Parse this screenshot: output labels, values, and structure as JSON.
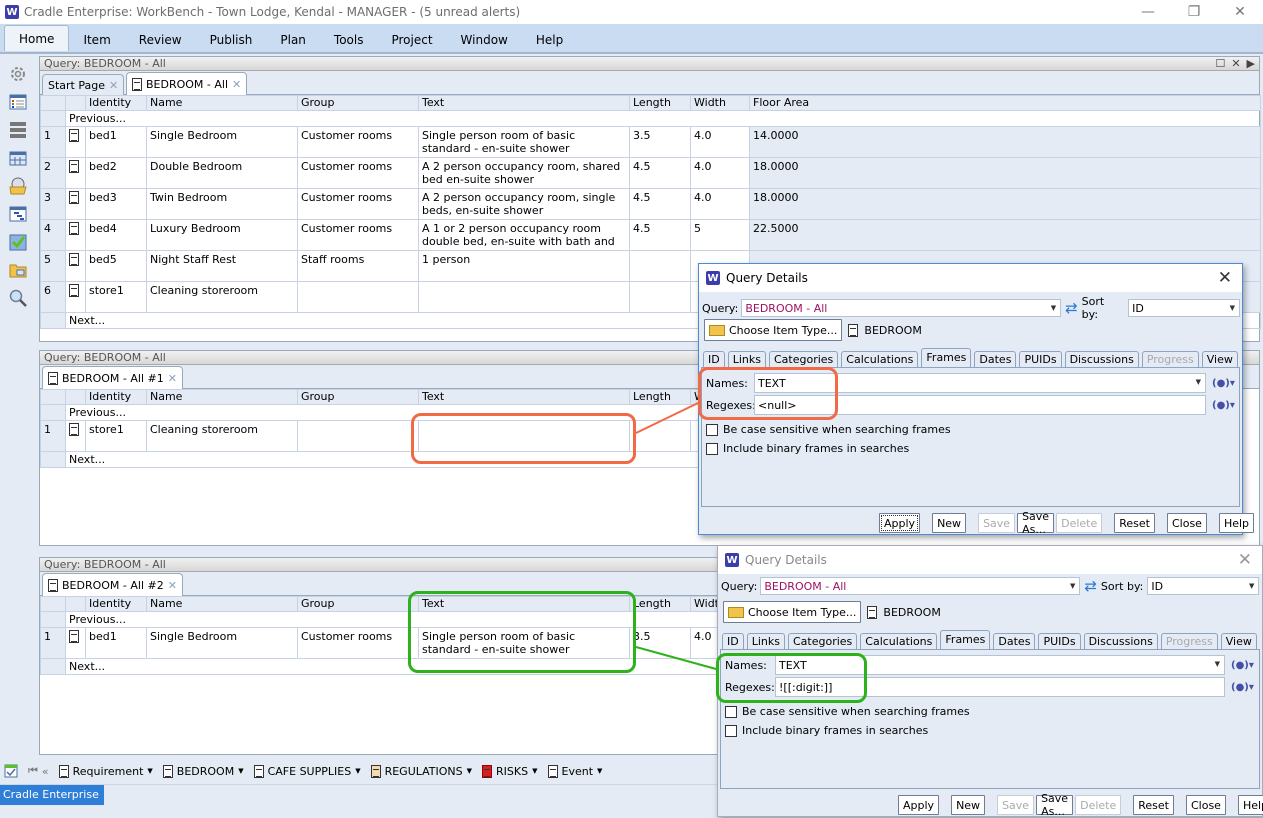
{
  "window": {
    "title": "Cradle Enterprise: WorkBench - Town Lodge, Kendal - MANAGER - (5 unread alerts)",
    "logo": "W",
    "controls": {
      "minimize": "—",
      "maximize": "❐",
      "close": "✕"
    }
  },
  "menu": [
    "Home",
    "Item",
    "Review",
    "Publish",
    "Plan",
    "Tools",
    "Project",
    "Window",
    "Help"
  ],
  "sidebar_icons": [
    "gear-icon",
    "list-view-icon",
    "database-icon",
    "calendar-icon",
    "open-query-icon",
    "gantt-icon",
    "checklist-icon",
    "folder-window-icon",
    "search-tools-icon"
  ],
  "columns": [
    "",
    "",
    "Identity",
    "Name",
    "Group",
    "Text",
    "Length",
    "Width",
    "Floor Area"
  ],
  "nav": {
    "previous": "Previous...",
    "next": "Next..."
  },
  "panel1": {
    "header": "Query: BEDROOM - All",
    "tabs": [
      {
        "label": "Start Page"
      },
      {
        "label": "BEDROOM - All"
      }
    ],
    "rows": [
      {
        "num": "1",
        "identity": "bed1",
        "name": "Single Bedroom",
        "group": "Customer rooms",
        "text": "Single person room of basic standard - en-suite shower",
        "length": "3.5",
        "width": "4.0",
        "area": "14.0000"
      },
      {
        "num": "2",
        "identity": "bed2",
        "name": "Double Bedroom",
        "group": "Customer rooms",
        "text": "A 2 person occupancy room, shared bed en-suite shower",
        "length": "4.5",
        "width": "4.0",
        "area": "18.0000"
      },
      {
        "num": "3",
        "identity": "bed3",
        "name": "Twin Bedroom",
        "group": "Customer rooms",
        "text": "A 2 person occupancy room, single beds, en-suite shower",
        "length": "4.5",
        "width": "4.0",
        "area": "18.0000"
      },
      {
        "num": "4",
        "identity": "bed4",
        "name": "Luxury Bedroom",
        "group": "Customer rooms",
        "text": "A 1 or 2 person occupancy room double bed, en-suite with bath and",
        "length": "4.5",
        "width": "5",
        "area": "22.5000"
      },
      {
        "num": "5",
        "identity": "bed5",
        "name": "Night Staff Rest",
        "group": "Staff rooms",
        "text": "1 person",
        "length": "",
        "width": "",
        "area": ""
      },
      {
        "num": "6",
        "identity": "store1",
        "name": "Cleaning storeroom",
        "group": "",
        "text": "",
        "length": "",
        "width": "",
        "area": ""
      }
    ]
  },
  "panel2": {
    "header": "Query: BEDROOM - All",
    "tabs": [
      {
        "label": "BEDROOM - All #1"
      }
    ],
    "rows": [
      {
        "num": "1",
        "identity": "store1",
        "name": "Cleaning storeroom",
        "group": "",
        "text": "",
        "length": ""
      }
    ]
  },
  "panel3": {
    "header": "Query: BEDROOM - All",
    "tabs": [
      {
        "label": "BEDROOM - All #2"
      }
    ],
    "rows": [
      {
        "num": "1",
        "identity": "bed1",
        "name": "Single Bedroom",
        "group": "Customer rooms",
        "text": "Single person room of basic standard - en-suite shower",
        "length": "3.5",
        "width": "4.0"
      }
    ]
  },
  "dialog1": {
    "title": "Query Details",
    "query_label": "Query:",
    "query_value": "BEDROOM - All",
    "sort_label": "Sort by:",
    "sort_value": "ID",
    "choose_button": "Choose Item Type...",
    "item_type": "BEDROOM",
    "tabs": [
      "ID",
      "Links",
      "Categories",
      "Calculations",
      "Frames",
      "Dates",
      "PUIDs",
      "Discussions",
      "Progress",
      "View"
    ],
    "active_tab": "Frames",
    "names_label": "Names:",
    "names_value": "TEXT",
    "regexes_label": "Regexes:",
    "regexes_value": "<null>",
    "case_sensitive_label": "Be case sensitive when searching frames",
    "case_sensitive_checked": false,
    "binary_label": "Include binary frames in searches",
    "binary_checked": false,
    "buttons": [
      "Apply",
      "New",
      "Save",
      "Save As...",
      "Delete",
      "Reset",
      "Close",
      "Help"
    ]
  },
  "dialog2": {
    "title": "Query Details",
    "query_label": "Query:",
    "query_value": "BEDROOM - All",
    "sort_label": "Sort by:",
    "sort_value": "ID",
    "choose_button": "Choose Item Type...",
    "item_type": "BEDROOM",
    "tabs": [
      "ID",
      "Links",
      "Categories",
      "Calculations",
      "Frames",
      "Dates",
      "PUIDs",
      "Discussions",
      "Progress",
      "View"
    ],
    "active_tab": "Frames",
    "names_label": "Names:",
    "names_value": "TEXT",
    "regexes_label": "Regexes:",
    "regexes_value": "![[:digit:]]",
    "case_sensitive_label": "Be case sensitive when searching frames",
    "case_sensitive_checked": false,
    "binary_label": "Include binary frames in searches",
    "binary_checked": false,
    "buttons": [
      "Apply",
      "New",
      "Save",
      "Save As...",
      "Delete",
      "Reset",
      "Close",
      "Help"
    ]
  },
  "bottom_toolbar": [
    "Requirement",
    "BEDROOM",
    "CAFE SUPPLIES",
    "REGULATIONS",
    "RISKS",
    "Event"
  ],
  "status": {
    "label": "Cradle Enterprise"
  },
  "colors": {
    "accent_blue": "#2f7ed8",
    "highlight_orange": "#f06a45",
    "highlight_green": "#2db21c",
    "query_name": "#a01060"
  }
}
